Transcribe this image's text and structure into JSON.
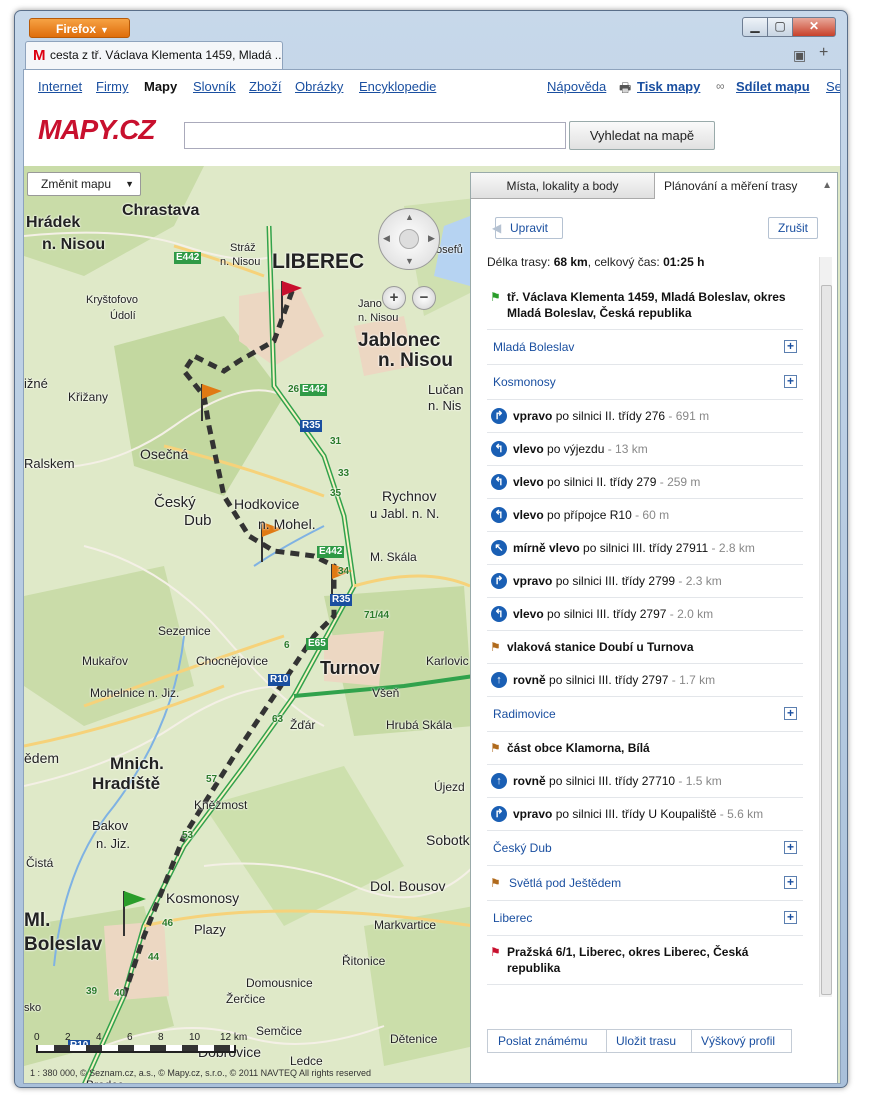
{
  "browser": {
    "app_button": "Firefox",
    "tab_title": "cesta z tř. Václava Klementa 1459, Mladá ..."
  },
  "nav": {
    "links": [
      "Internet",
      "Firmy",
      "Mapy",
      "Slovník",
      "Zboží",
      "Obrázky",
      "Encyklopedie"
    ],
    "help": "Nápověda",
    "print": "Tisk mapy",
    "share": "Sdílet mapu",
    "se": "Se"
  },
  "logo": "MAPY.CZ",
  "search": {
    "value": "",
    "button": "Vyhledat na mapě"
  },
  "map": {
    "change_map": "Změnit mapu",
    "labels": [
      "Chrastava",
      "Hrádek",
      "n. Nisou",
      "Stráž",
      "n. Nisou",
      "LIBEREC",
      "Kryštofovo",
      "Údolí",
      "Jablonec",
      "n. Nisou",
      "Jano",
      "n. Nisou",
      "Křižany",
      "Lučan",
      "n. Nis",
      "Ralskem",
      "Osečná",
      "Český",
      "Dub",
      "Hodkovice",
      "n. Mohel.",
      "Rychnov",
      "u Jabl. n. N.",
      "M. Skála",
      "Sezemice",
      "Mukařov",
      "Chocnějovice",
      "Turnov",
      "Karlovic",
      "Mohelnice n. Jiz.",
      "Všeň",
      "Žďár",
      "Hrubá Skála",
      "ědem",
      "Mnich.",
      "Hradiště",
      "Újezd",
      "Kněžmost",
      "Bakov",
      "n. Jiz.",
      "Sobotk",
      "Čistá",
      "Dol. Bousov",
      "Kosmonosy",
      "Ml.",
      "Boleslav",
      "Plazy",
      "Markvartice",
      "Řitonice",
      "Domousnice",
      "Žerčice",
      "Semčice",
      "Dětenice",
      "Dobrovice",
      "Ledce",
      "sko",
      "Brodce",
      "ižné",
      "osefů"
    ],
    "road_numbers": [
      "E442",
      "E442",
      "E442",
      "26",
      "R35",
      "31",
      "33",
      "35",
      "R35",
      "71/44",
      "E65",
      "E65",
      "R10",
      "R10",
      "63",
      "57",
      "53",
      "46",
      "44",
      "40",
      "39",
      "34",
      "6"
    ],
    "zoom_in": "+",
    "zoom_out": "−",
    "scale_ticks": [
      "0",
      "2",
      "4",
      "6",
      "8",
      "10",
      "12 km"
    ],
    "copyright": "1 : 380 000, © Seznam.cz, a.s., © Mapy.cz, s.r.o., © 2011 NAVTEQ All rights reserved"
  },
  "panel": {
    "tab1": "Místa, lokality a body",
    "tab2": "Plánování a měření trasy",
    "edit": "Upravit",
    "cancel": "Zrušit",
    "summary_label": "Délka trasy: ",
    "length": "68 km",
    "mid": ", celkový čas: ",
    "time": "01:25 h",
    "items": [
      {
        "kind": "wp",
        "flag": "#2a9d2a",
        "text": "tř. Václava Klementa 1459, Mladá Boleslav, okres Mladá Boleslav, Česká republika"
      },
      {
        "kind": "place",
        "text": "Mladá Boleslav"
      },
      {
        "kind": "place",
        "text": "Kosmonosy"
      },
      {
        "kind": "step",
        "dir": "right",
        "bold": "vpravo",
        "text": " po silnici II. třídy 276",
        "dist": " - 691 m"
      },
      {
        "kind": "step",
        "dir": "left",
        "bold": "vlevo",
        "text": " po výjezdu",
        "dist": " - 13 km"
      },
      {
        "kind": "step",
        "dir": "left",
        "bold": "vlevo",
        "text": " po silnici II. třídy 279",
        "dist": " - 259 m"
      },
      {
        "kind": "step",
        "dir": "left",
        "bold": "vlevo",
        "text": " po přípojce R10",
        "dist": " - 60 m"
      },
      {
        "kind": "step",
        "dir": "sleft",
        "bold": "mírně vlevo",
        "text": " po silnici III. třídy 27911",
        "dist": " - 2.8 km"
      },
      {
        "kind": "step",
        "dir": "right",
        "bold": "vpravo",
        "text": " po silnici III. třídy 2799",
        "dist": " - 2.3 km"
      },
      {
        "kind": "step",
        "dir": "left",
        "bold": "vlevo",
        "text": " po silnici III. třídy 2797",
        "dist": " - 2.0 km"
      },
      {
        "kind": "wp",
        "flag": "#b06a1c",
        "text": "vlaková stanice Doubí u Turnova"
      },
      {
        "kind": "step",
        "dir": "up",
        "bold": "rovně",
        "text": " po silnici III. třídy 2797",
        "dist": " - 1.7 km"
      },
      {
        "kind": "place",
        "text": "Radimovice"
      },
      {
        "kind": "wp",
        "flag": "#b06a1c",
        "text": "část obce Klamorna, Bílá"
      },
      {
        "kind": "step",
        "dir": "up",
        "bold": "rovně",
        "text": " po silnici III. třídy 27710",
        "dist": " - 1.5 km"
      },
      {
        "kind": "step",
        "dir": "right",
        "bold": "vpravo",
        "text": " po silnici III. třídy U Koupaliště",
        "dist": " - 5.6 km"
      },
      {
        "kind": "place",
        "text": "Český Dub"
      },
      {
        "kind": "placewp",
        "flag": "#b06a1c",
        "text": "Světlá pod Ještědem"
      },
      {
        "kind": "place",
        "text": "Liberec"
      },
      {
        "kind": "wp",
        "flag": "#c8102e",
        "text": "Pražská 6/1, Liberec, okres Liberec, Česká republika"
      }
    ],
    "actions": [
      "Poslat známému",
      "Uložit trasu",
      "Výškový profil"
    ]
  },
  "colors": {
    "link": "#1a4fa0",
    "route": "#333333",
    "start_flag": "#2a9d2a",
    "via_flag": "#e07a14",
    "end_flag": "#c8102e"
  }
}
